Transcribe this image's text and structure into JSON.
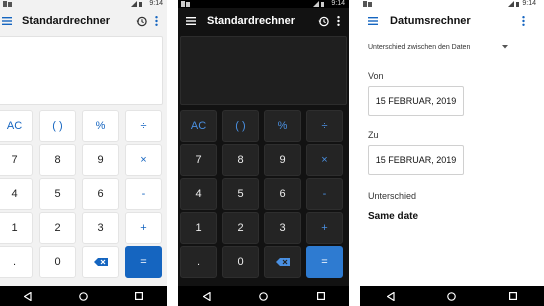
{
  "status": {
    "time": "9:14"
  },
  "standard": {
    "title": "Standardrechner",
    "keys": [
      [
        "AC",
        "( )",
        "%",
        "÷"
      ],
      [
        "7",
        "8",
        "9",
        "×"
      ],
      [
        "4",
        "5",
        "6",
        "-"
      ],
      [
        "1",
        "2",
        "3",
        "+"
      ],
      [
        ".",
        "0",
        "⌫",
        "="
      ]
    ]
  },
  "date_calc": {
    "title": "Datumsrechner",
    "mode": "Unterschied zwischen den Daten",
    "from_label": "Von",
    "from_value": "15 FEBRUAR, 2019",
    "to_label": "Zu",
    "to_value": "15 FEBRUAR, 2019",
    "result_label": "Unterschied",
    "result_value": "Same date"
  },
  "colors": {
    "accent_light": "#1565c0",
    "accent_dark": "#2e7bd1",
    "dark_bg": "#121212"
  }
}
